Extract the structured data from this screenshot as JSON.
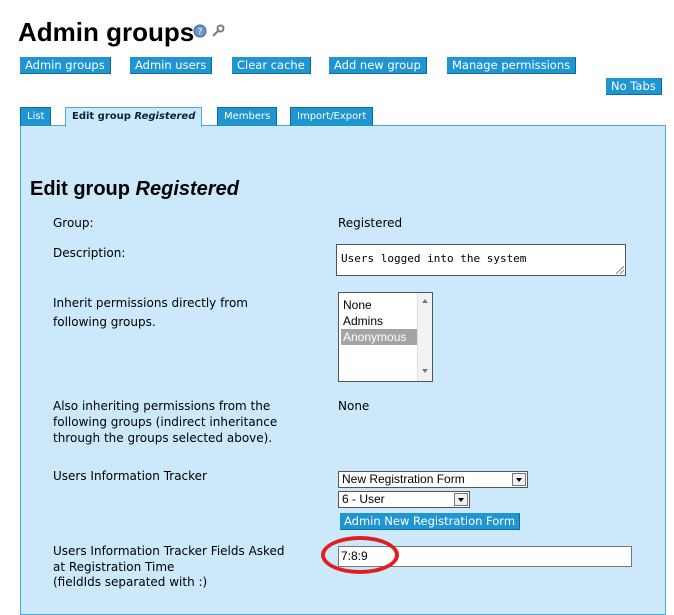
{
  "header": {
    "title": "Admin groups"
  },
  "toolbar": {
    "admin_groups": "Admin groups",
    "admin_users": "Admin users",
    "clear_cache": "Clear cache",
    "add_new_group": "Add new group",
    "manage_permissions": "Manage permissions",
    "no_tabs": "No Tabs"
  },
  "tabs": {
    "list": "List",
    "edit_group_prefix": "Edit group ",
    "edit_group_name": "Registered",
    "members": "Members",
    "import_export": "Import/Export"
  },
  "form": {
    "heading_prefix": "Edit group ",
    "heading_name": "Registered",
    "group_label": "Group:",
    "group_value": "Registered",
    "description_label": "Description:",
    "description_value": "Users logged into the system",
    "inherit_label_1": "Inherit permissions directly from",
    "inherit_label_2": "following groups.",
    "inherit_options": [
      "None",
      "Admins",
      "Anonymous"
    ],
    "inherit_selected": "Anonymous",
    "also_label_1": "Also inheriting permissions from the",
    "also_label_2": "following groups (indirect inheritance",
    "also_label_3": "through the groups selected above).",
    "also_value": "None",
    "tracker_label": "Users Information Tracker",
    "tracker_select": "New Registration Form",
    "tracker_user_select": "6 - User",
    "admin_tracker_button": "Admin New Registration Form",
    "fields_label_1": "Users Information Tracker Fields Asked",
    "fields_label_2": "at Registration Time",
    "fields_label_3": "(fieldIds separated with :)",
    "fields_value": "7:8:9"
  },
  "colors": {
    "accent": "#1f95d1",
    "panel": "#cbe9fb",
    "highlight": "#e02020"
  }
}
